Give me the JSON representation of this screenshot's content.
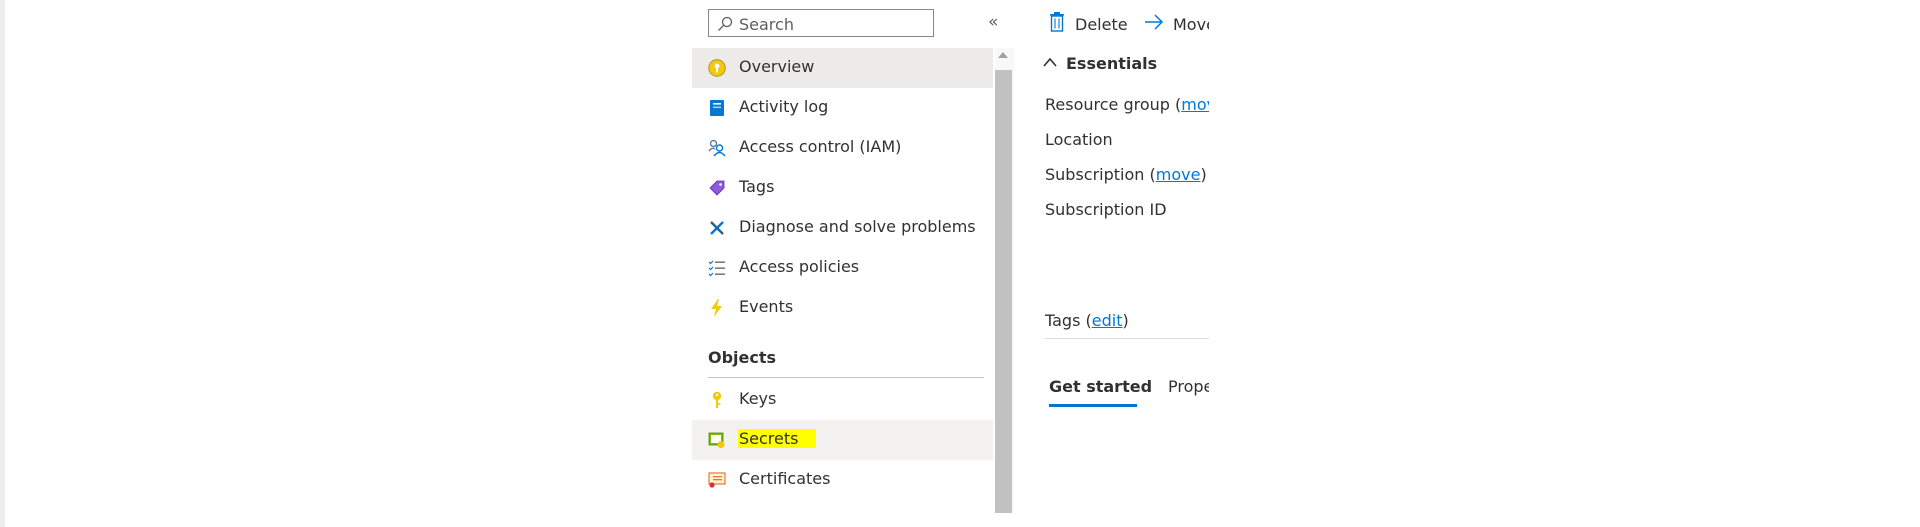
{
  "search": {
    "placeholder": "Search"
  },
  "nav": {
    "collapse_icon": "«",
    "items": [
      {
        "label": "Overview",
        "icon": "overview-icon"
      },
      {
        "label": "Activity log",
        "icon": "activity-log-icon"
      },
      {
        "label": "Access control (IAM)",
        "icon": "people-icon"
      },
      {
        "label": "Tags",
        "icon": "tag-icon"
      },
      {
        "label": "Diagnose and solve problems",
        "icon": "wrench-icon"
      },
      {
        "label": "Access policies",
        "icon": "list-check-icon"
      },
      {
        "label": "Events",
        "icon": "lightning-icon"
      }
    ],
    "section_title": "Objects",
    "objects": [
      {
        "label": "Keys",
        "icon": "key-icon"
      },
      {
        "label": "Secrets",
        "icon": "secret-icon"
      },
      {
        "label": "Certificates",
        "icon": "certificate-icon"
      }
    ]
  },
  "toolbar": {
    "delete_label": "Delete",
    "move_label": "Move"
  },
  "essentials": {
    "header": "Essentials",
    "resource_group_label": "Resource group (",
    "resource_group_link": "move",
    "location_label": "Location",
    "subscription_label": "Subscription (",
    "subscription_link": "move",
    "subscription_close": ")",
    "subscription_id_label": "Subscription ID",
    "tags_label": "Tags (",
    "tags_link": "edit",
    "tags_close": ")"
  },
  "tabs": [
    {
      "label": "Get started"
    },
    {
      "label": "Properties"
    }
  ],
  "colors": {
    "accent": "#0078d4",
    "highlight": "#ffff00",
    "selected_bg": "#edebe9"
  }
}
